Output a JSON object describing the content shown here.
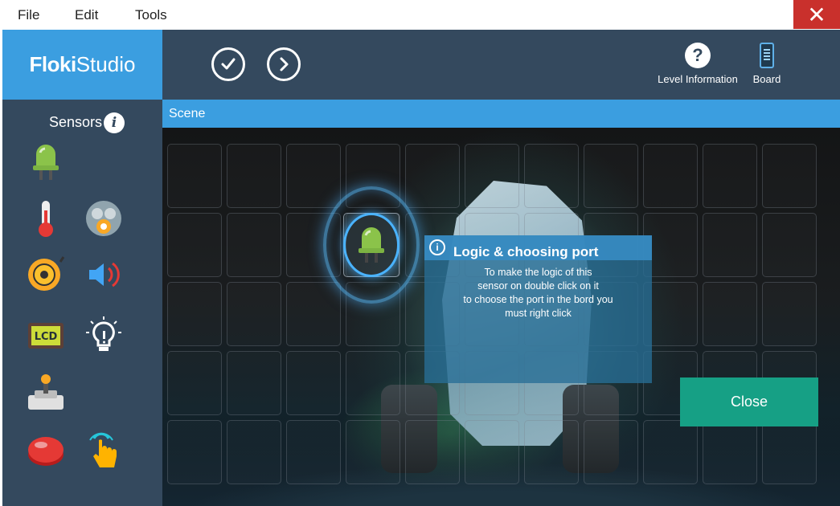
{
  "menu": {
    "items": [
      "File",
      "Edit",
      "Tools"
    ],
    "close_symbol": "✕"
  },
  "logo": {
    "bold": "Floki",
    "light": "Studio"
  },
  "toolbar": {
    "check_icon": "check-circle-icon",
    "next_icon": "arrow-right-circle-icon",
    "level_info_label": "Level Information",
    "board_label": "Board"
  },
  "sidebar": {
    "title": "Sensors",
    "info_symbol": "i",
    "sensors": [
      {
        "name": "led-sensor-icon"
      },
      {
        "name": "thermometer-sensor-icon"
      },
      {
        "name": "gas-sensor-icon"
      },
      {
        "name": "buzzer-sensor-icon"
      },
      {
        "name": "speaker-sensor-icon"
      },
      {
        "name": "lcd-sensor-icon"
      },
      {
        "name": "light-bulb-sensor-icon"
      },
      {
        "name": "joystick-sensor-icon"
      },
      {
        "name": "push-button-sensor-icon"
      },
      {
        "name": "touch-sensor-icon"
      }
    ],
    "lcd_text": "LCD"
  },
  "scene": {
    "label": "Scene",
    "placed_sensor": "led-sensor-icon"
  },
  "tooltip": {
    "icon": "info-circle-icon",
    "title": "Logic & choosing port",
    "lines": [
      "To make the logic of this",
      "sensor on double click on it",
      "to choose the port in the bord you",
      "must right click"
    ]
  },
  "close_button": {
    "label": "Close"
  },
  "colors": {
    "sidebar": "#34495e",
    "accent_blue": "#3b9ee0",
    "close_red": "#c9302c",
    "close_green": "#16a085"
  }
}
